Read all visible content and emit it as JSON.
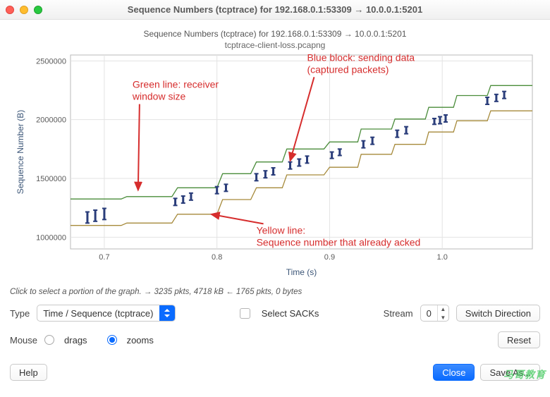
{
  "title": "Sequence Numbers (tcptrace) for 192.168.0.1:53309 → 10.0.0.1:5201",
  "chart": {
    "title": "Sequence Numbers (tcptrace) for 192.168.0.1:53309 → 10.0.0.1:5201",
    "subtitle": "tcptrace-client-loss.pcapng",
    "xlabel": "Time (s)",
    "ylabel": "Sequence Number (B)"
  },
  "chart_data": {
    "type": "line",
    "xlim": [
      0.67,
      1.08
    ],
    "ylim": [
      900000,
      2550000
    ],
    "x_ticks": [
      0.7,
      0.8,
      0.9,
      1.0
    ],
    "y_ticks": [
      1000000,
      1500000,
      2000000,
      2500000
    ],
    "series": [
      {
        "name": "receiver-window (green)",
        "stroke": "#4a8c3a",
        "points": [
          [
            0.67,
            1325000
          ],
          [
            0.715,
            1325000
          ],
          [
            0.72,
            1345000
          ],
          [
            0.76,
            1345000
          ],
          [
            0.765,
            1420000
          ],
          [
            0.8,
            1420000
          ],
          [
            0.805,
            1540000
          ],
          [
            0.83,
            1540000
          ],
          [
            0.835,
            1640000
          ],
          [
            0.858,
            1640000
          ],
          [
            0.862,
            1750000
          ],
          [
            0.895,
            1750000
          ],
          [
            0.9,
            1810000
          ],
          [
            0.925,
            1810000
          ],
          [
            0.928,
            1920000
          ],
          [
            0.955,
            1920000
          ],
          [
            0.958,
            2005000
          ],
          [
            0.985,
            2005000
          ],
          [
            0.988,
            2105000
          ],
          [
            1.01,
            2105000
          ],
          [
            1.013,
            2205000
          ],
          [
            1.04,
            2205000
          ],
          [
            1.043,
            2290000
          ],
          [
            1.08,
            2290000
          ]
        ]
      },
      {
        "name": "acked (yellow)",
        "stroke": "#a68a3b",
        "points": [
          [
            0.67,
            1100000
          ],
          [
            0.715,
            1100000
          ],
          [
            0.72,
            1120000
          ],
          [
            0.76,
            1120000
          ],
          [
            0.765,
            1195000
          ],
          [
            0.8,
            1195000
          ],
          [
            0.805,
            1320000
          ],
          [
            0.83,
            1320000
          ],
          [
            0.835,
            1420000
          ],
          [
            0.858,
            1420000
          ],
          [
            0.862,
            1530000
          ],
          [
            0.895,
            1530000
          ],
          [
            0.9,
            1595000
          ],
          [
            0.925,
            1595000
          ],
          [
            0.928,
            1705000
          ],
          [
            0.955,
            1705000
          ],
          [
            0.958,
            1790000
          ],
          [
            0.985,
            1790000
          ],
          [
            0.988,
            1895000
          ],
          [
            1.01,
            1895000
          ],
          [
            1.013,
            1990000
          ],
          [
            1.04,
            1990000
          ],
          [
            1.043,
            2075000
          ],
          [
            1.08,
            2075000
          ]
        ]
      },
      {
        "name": "sending-data (blue blocks)",
        "stroke": "#2a3d7a",
        "segments": [
          [
            0.685,
            1120000,
            1215000
          ],
          [
            0.692,
            1135000,
            1230000
          ],
          [
            0.7,
            1150000,
            1245000
          ],
          [
            0.763,
            1270000,
            1330000
          ],
          [
            0.77,
            1290000,
            1350000
          ],
          [
            0.777,
            1315000,
            1375000
          ],
          [
            0.8,
            1370000,
            1430000
          ],
          [
            0.808,
            1390000,
            1450000
          ],
          [
            0.835,
            1480000,
            1540000
          ],
          [
            0.843,
            1505000,
            1565000
          ],
          [
            0.85,
            1530000,
            1590000
          ],
          [
            0.865,
            1580000,
            1640000
          ],
          [
            0.873,
            1605000,
            1665000
          ],
          [
            0.88,
            1630000,
            1690000
          ],
          [
            0.902,
            1670000,
            1725000
          ],
          [
            0.909,
            1695000,
            1750000
          ],
          [
            0.93,
            1760000,
            1820000
          ],
          [
            0.938,
            1790000,
            1850000
          ],
          [
            0.96,
            1850000,
            1910000
          ],
          [
            0.968,
            1880000,
            1940000
          ],
          [
            0.993,
            1960000,
            2010000
          ],
          [
            0.998,
            1965000,
            2025000
          ],
          [
            1.003,
            1980000,
            2040000
          ],
          [
            1.04,
            2130000,
            2190000
          ],
          [
            1.048,
            2155000,
            2215000
          ],
          [
            1.055,
            2180000,
            2240000
          ]
        ]
      }
    ],
    "annotations": [
      {
        "id": "green",
        "lines": [
          "Green line: receiver",
          "window size"
        ],
        "pos": [
          0.725,
          2270000
        ],
        "arrow_to": [
          0.73,
          1400000
        ]
      },
      {
        "id": "blue",
        "lines": [
          "Blue block: sending data",
          "(captured packets)"
        ],
        "pos": [
          0.88,
          2500000
        ],
        "arrow_to": [
          0.865,
          1650000
        ]
      },
      {
        "id": "yellow",
        "lines": [
          "Yellow line:",
          "Sequence number that already acked"
        ],
        "pos": [
          0.835,
          1030000
        ],
        "arrow_to": [
          0.795,
          1195000
        ]
      }
    ]
  },
  "status": "Click to select a portion of the graph. → 3235 pkts, 4718 kB ← 1765 pkts, 0 bytes",
  "controls": {
    "type_label": "Type",
    "type_value": "Time / Sequence (tcptrace)",
    "sack_label": "Select SACKs",
    "stream_label": "Stream",
    "stream_value": "0",
    "switch_label": "Switch Direction",
    "mouse_label": "Mouse",
    "drags_label": "drags",
    "zooms_label": "zooms",
    "reset_label": "Reset",
    "help_label": "Help",
    "close_label": "Close",
    "save_label": "Save As..."
  },
  "watermark": "马哥教育"
}
